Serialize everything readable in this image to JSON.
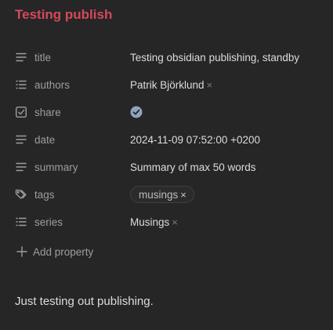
{
  "note": {
    "title": "Testing publish",
    "body": "Just testing out publishing."
  },
  "properties": [
    {
      "key": "title",
      "icon": "text-lines-icon",
      "value": "Testing obsidian publishing, standby"
    },
    {
      "key": "authors",
      "icon": "list-icon",
      "value": "Patrik Björklund",
      "remove": "×"
    },
    {
      "key": "share",
      "icon": "checkbox-icon",
      "value_checked": true
    },
    {
      "key": "date",
      "icon": "text-lines-icon",
      "value": "2024-11-09 07:52:00 +0200"
    },
    {
      "key": "summary",
      "icon": "text-lines-icon",
      "value": "Summary of max 50 words"
    },
    {
      "key": "tags",
      "icon": "tags-icon",
      "value": "musings",
      "remove": "×"
    },
    {
      "key": "series",
      "icon": "list-icon",
      "value": "Musings",
      "remove": "×"
    }
  ],
  "add_property": {
    "label": "Add property",
    "icon": "plus-icon"
  },
  "colors": {
    "title": "#d4495a",
    "background": "#262626",
    "key_text": "#9d9d9d",
    "value_text": "#dcdcdc",
    "check": "#8fa4c0"
  }
}
